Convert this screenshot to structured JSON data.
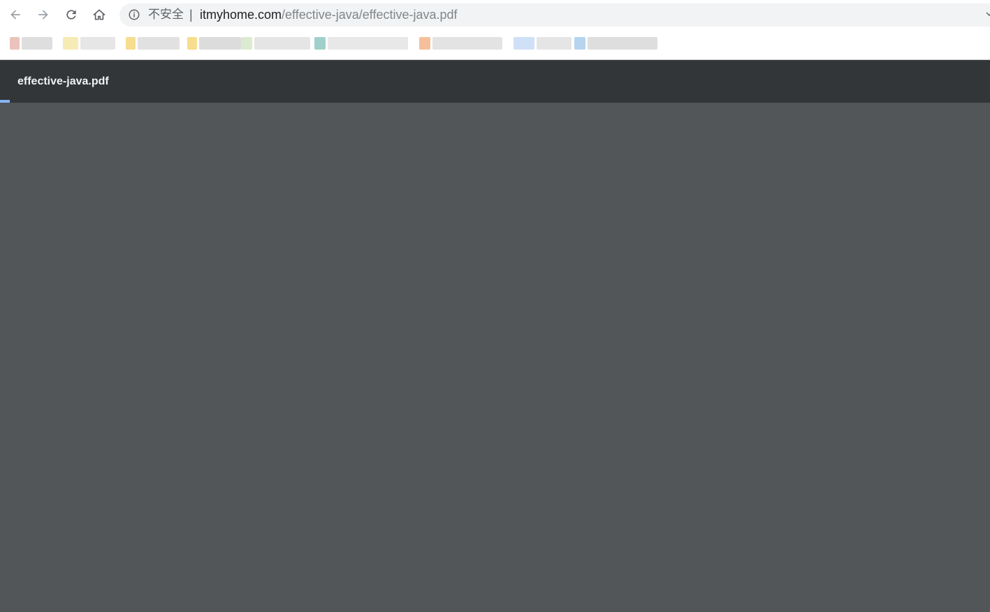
{
  "browser": {
    "security_label": "不安全",
    "separator": "|",
    "url_host": "itmyhome.com",
    "url_path": "/effective-java/effective-java.pdf"
  },
  "icons": {
    "back": "arrow-left-icon",
    "forward": "arrow-right-icon",
    "reload": "reload-icon",
    "home": "home-icon",
    "info": "info-icon",
    "chevron": "chevron-down-icon"
  },
  "pdf_viewer": {
    "title": "effective-java.pdf",
    "load_progress": 0.01
  },
  "colors": {
    "viewer_header": "#323639",
    "viewer_background": "#525659",
    "progress": "#8ab4f8"
  }
}
